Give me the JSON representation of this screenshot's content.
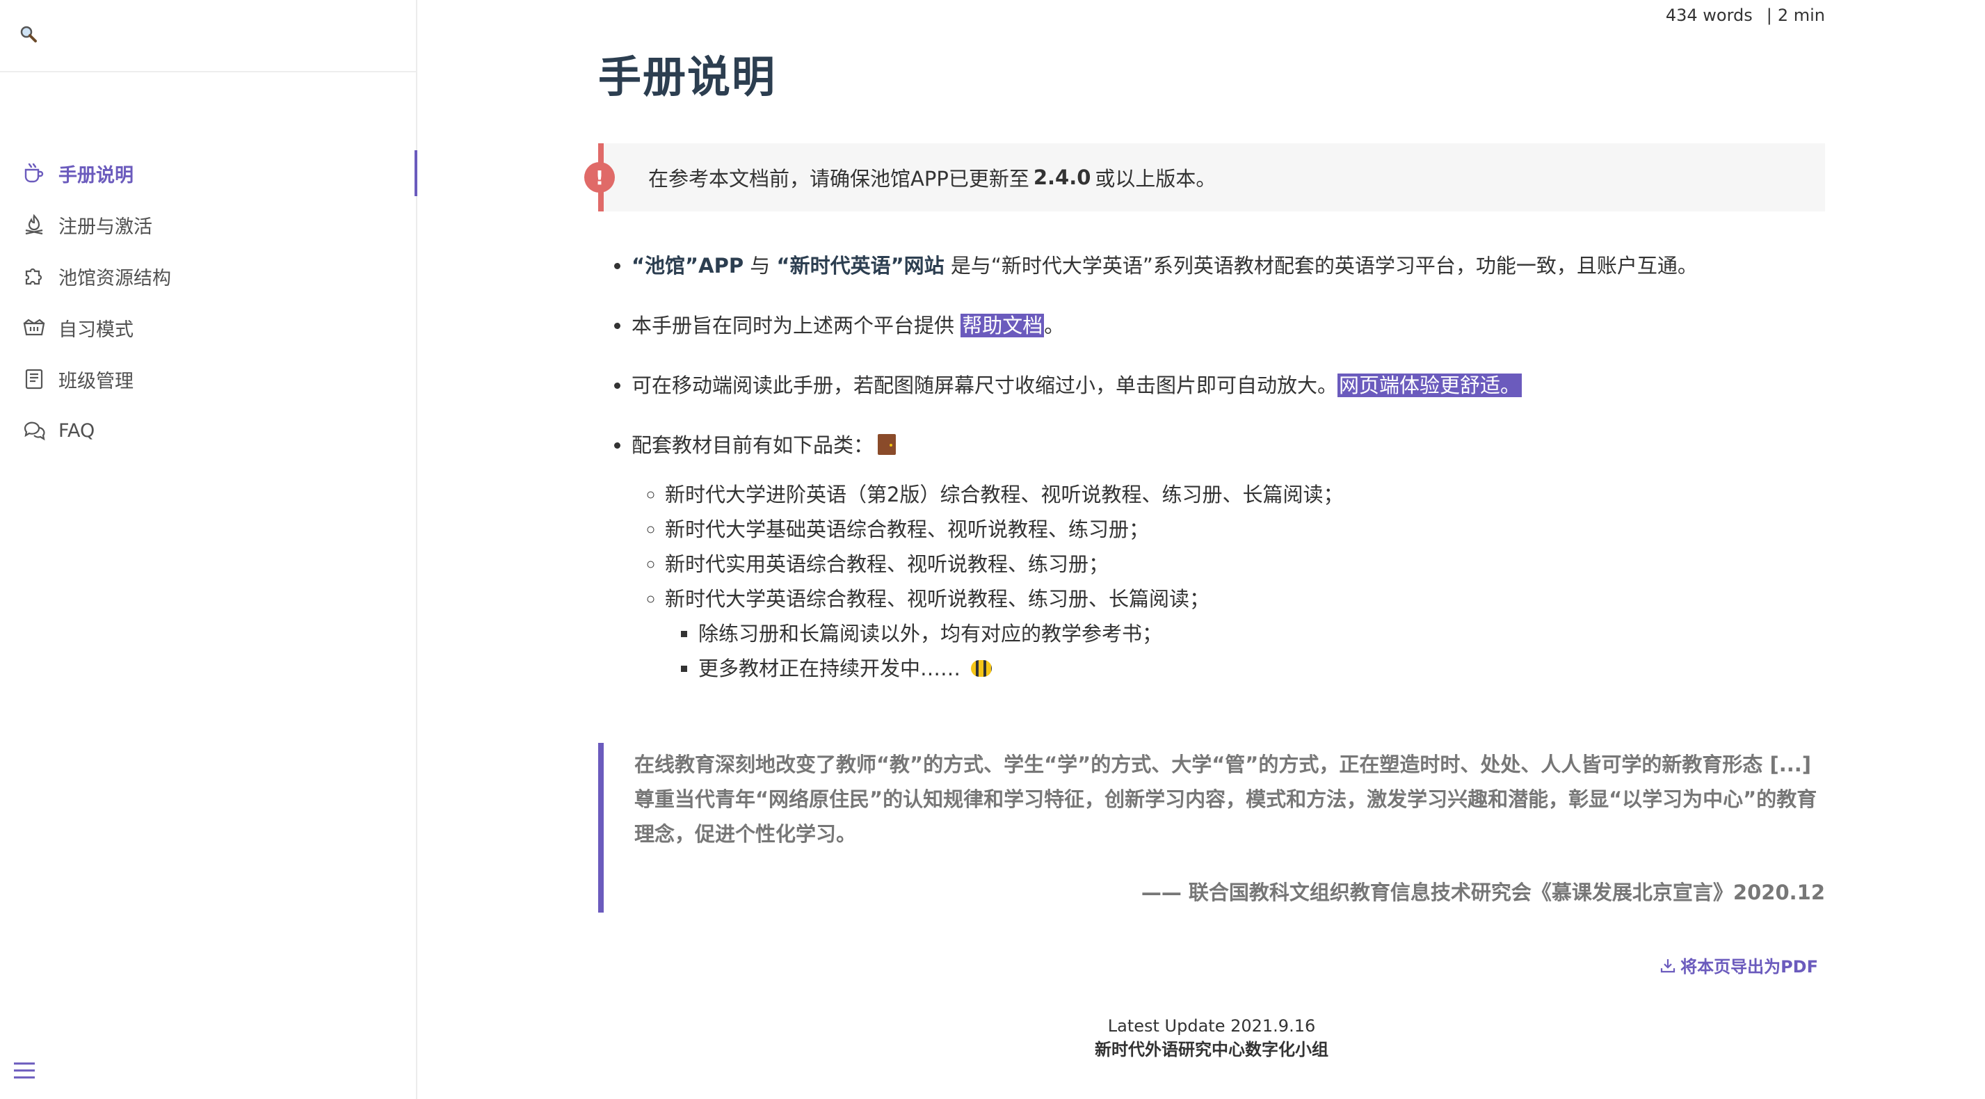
{
  "search": {
    "placeholder": ""
  },
  "sidebar": {
    "items": [
      {
        "label": "手册说明",
        "icon": "coffee-cup-icon",
        "active": true
      },
      {
        "label": "注册与激活",
        "icon": "campfire-icon",
        "active": false
      },
      {
        "label": "池馆资源结构",
        "icon": "puzzle-icon",
        "active": false
      },
      {
        "label": "自习模式",
        "icon": "basket-icon",
        "active": false
      },
      {
        "label": "班级管理",
        "icon": "notebook-icon",
        "active": false
      },
      {
        "label": "FAQ",
        "icon": "chat-bubbles-icon",
        "active": false
      }
    ]
  },
  "meta": {
    "words": "434 words",
    "time": "2 min"
  },
  "page": {
    "title": "手册说明"
  },
  "tip": {
    "prefix": "在参考本文档前，请确保池馆APP已更新至",
    "version": "2.4.0",
    "suffix": "或以上版本。"
  },
  "bullets": {
    "b1": {
      "app": "“池馆”APP",
      "and": "与",
      "site": "“新时代英语”网站",
      "rest": "是与“新时代大学英语”系列英语教材配套的英语学习平台，功能一致，且账户互通。"
    },
    "b2": {
      "text": "本手册旨在同时为上述两个平台提供",
      "highlight": "帮助文档",
      "end": "。"
    },
    "b3": {
      "text": "可在移动端阅读此手册，若配图随屏幕尺寸收缩过小，单击图片即可自动放大。",
      "highlight": "网页端体验更舒适。"
    },
    "b4": {
      "text": "配套教材目前有如下品类："
    }
  },
  "textbooks": [
    "新时代大学进阶英语（第2版）综合教程、视听说教程、练习册、长篇阅读；",
    "新时代大学基础英语综合教程、视听说教程、练习册；",
    "新时代实用英语综合教程、视听说教程、练习册；",
    "新时代大学英语综合教程、视听说教程、练习册、长篇阅读；"
  ],
  "subnotes": [
    "除练习册和长篇阅读以外，均有对应的教学参考书；",
    "更多教材正在持续开发中……"
  ],
  "quote": {
    "text": "在线教育深刻地改变了教师“教”的方式、学生“学”的方式、大学“管”的方式，正在塑造时时、处处、人人皆可学的新教育形态 [...] 尊重当代青年“网络原住民”的认知规律和学习特征，创新学习内容，模式和方法，激发学习兴趣和潜能，彰显“以学习为中心”的教育理念，促进个性化学习。",
    "cite": "—— 联合国教科文组织教育信息技术研究会《慕课发展北京宣言》2020.12"
  },
  "pdf": {
    "label": "将本页导出为PDF"
  },
  "footer": {
    "update": "Latest Update 2021.9.16",
    "team": "新时代外语研究中心数字化小组"
  },
  "colors": {
    "accent": "#6b5bbd",
    "tip_red": "#e06a68"
  }
}
